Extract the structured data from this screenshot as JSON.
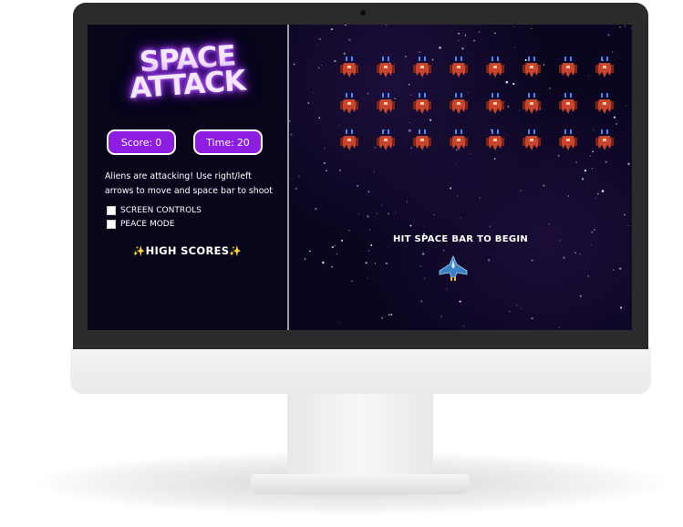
{
  "logo": {
    "line1": "SPACE",
    "line2": "ATTACK"
  },
  "score": {
    "label": "Score:",
    "value": "0"
  },
  "time": {
    "label": "Time:",
    "value": "20"
  },
  "instructions": "Aliens are attacking! Use right/left arrows to move and space bar to shoot",
  "options": [
    {
      "label": "SCREEN CONTROLS",
      "checked": false
    },
    {
      "label": "PEACE MODE",
      "checked": false
    }
  ],
  "high_scores": {
    "label": "HIGH SCORES",
    "decoration": "✨"
  },
  "game": {
    "prompt": "HIT SPACE BAR TO BEGIN",
    "alien_rows": 3,
    "alien_cols": 8
  },
  "colors": {
    "accent_purple": "#8d1de0",
    "alien_red": "#c9442b",
    "alien_flame": "#3c8bff",
    "ship_blue": "#3b82c4"
  }
}
